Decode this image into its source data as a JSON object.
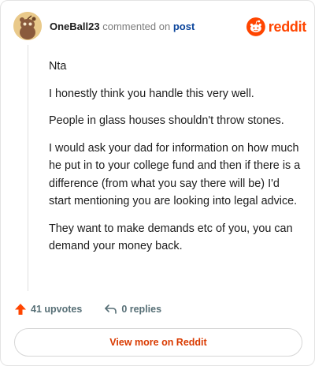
{
  "header": {
    "username": "OneBall23",
    "commented_text": "commented on",
    "post_link": "post"
  },
  "brand": {
    "name": "reddit",
    "color": "#ff4500",
    "icon": "reddit-snoo-icon"
  },
  "comment": {
    "paragraphs": [
      "Nta",
      "I honestly think you handle this very well.",
      "People in glass houses shouldn't throw stones.",
      "I would ask your dad for information on how much he put in to your college fund and then if there is a difference (from what you say there will be) I'd start mentioning you are looking into legal advice.",
      "They want to make demands etc of you, you can demand your money back."
    ]
  },
  "actions": {
    "upvotes_label": "41 upvotes",
    "upvote_icon": "upvote-arrow-icon",
    "replies_label": "0 replies",
    "reply_icon": "reply-arrow-icon"
  },
  "view_more_label": "View more on Reddit"
}
